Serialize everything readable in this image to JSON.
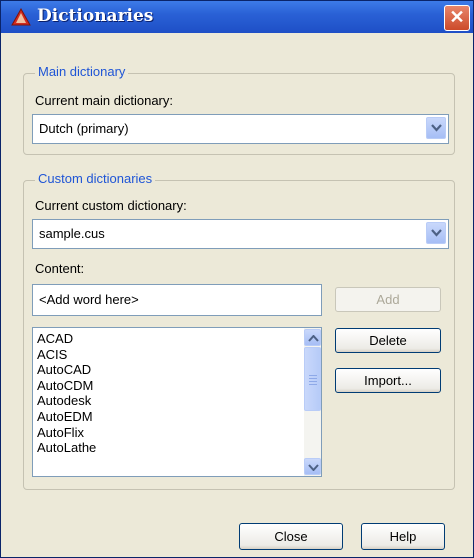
{
  "window": {
    "title": "Dictionaries",
    "close_glyph": "✕",
    "icon": "autocad-icon"
  },
  "main_group": {
    "legend": "Main dictionary",
    "label": "Current main dictionary:",
    "value": "Dutch (primary)"
  },
  "custom_group": {
    "legend": "Custom dictionaries",
    "label": "Current custom dictionary:",
    "value": "sample.cus",
    "content_label": "Content:",
    "word_input": "<Add word here>",
    "add_label": "Add",
    "delete_label": "Delete",
    "import_label": "Import...",
    "words": [
      "ACAD",
      "ACIS",
      "AutoCAD",
      "AutoCDM",
      "Autodesk",
      "AutoEDM",
      "AutoFlix",
      "AutoLathe"
    ]
  },
  "footer": {
    "close_label": "Close",
    "help_label": "Help"
  },
  "colors": {
    "title_bar": "#2a61d6",
    "legend_text": "#1f55d6",
    "dialog_bg": "#ece9d8"
  }
}
